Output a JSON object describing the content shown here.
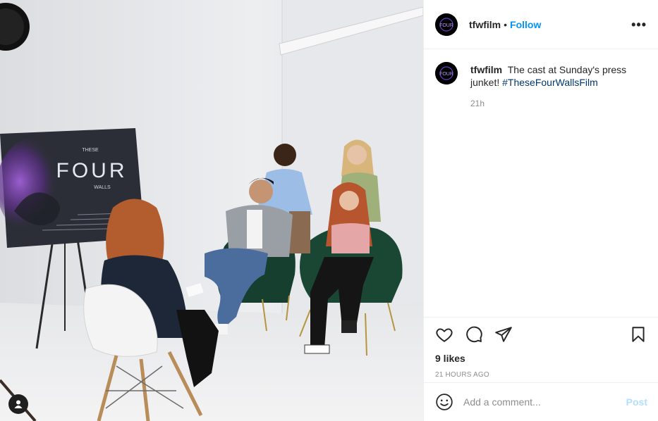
{
  "post": {
    "username": "tfwfilm",
    "follow_label": "Follow",
    "separator": "•",
    "more_label": "•••",
    "caption_text": "The cast at Sunday's press junket!",
    "caption_hashtag": "#TheseFourWallsFilm",
    "caption_age": "21h",
    "likes": "9 likes",
    "timestamp": "21 HOURS AGO",
    "comment_placeholder": "Add a comment...",
    "post_label": "Post",
    "poster": {
      "line_top": "THESE",
      "line_main": "FOUR",
      "line_bottom": "WALLS"
    }
  },
  "colors": {
    "accent": "#0095f6",
    "hashtag": "#00376b",
    "post_disabled": "#b2dffc",
    "muted": "#8e8e8e",
    "avatar_ring": "#6a3fc7"
  },
  "icons": {
    "header_avatar": "tfw-logo-icon",
    "like": "heart-icon",
    "comment": "speech-bubble-icon",
    "share": "paper-plane-icon",
    "save": "bookmark-icon",
    "emoji": "smiley-icon",
    "tag": "person-icon"
  }
}
